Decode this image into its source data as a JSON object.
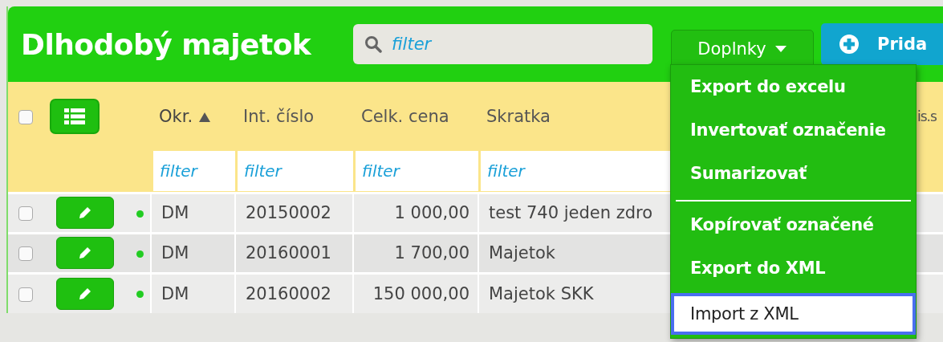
{
  "title": "Dlhodobý majetok",
  "search": {
    "placeholder": "filter"
  },
  "tools_button": {
    "label": "Doplnky",
    "expanded": true
  },
  "add_button": {
    "label": "Prida"
  },
  "header": {
    "select_all_checked": false
  },
  "columns": [
    {
      "label": "Okr.",
      "sorted": true,
      "filter_placeholder": "filter"
    },
    {
      "label": "Int. číslo",
      "sorted": false,
      "filter_placeholder": "filter"
    },
    {
      "label": "Celk. cena",
      "sorted": false,
      "filter_placeholder": "filter"
    },
    {
      "label": "Skratka",
      "sorted": false,
      "filter_placeholder": "filter"
    },
    {
      "label": "is.s",
      "sorted": false
    }
  ],
  "rows": [
    {
      "checked": false,
      "color": "#22cc22",
      "okr": "DM",
      "int_cislo": "20150002",
      "celk_cena": "1 000,00",
      "skratka": "test 740 jeden zdro"
    },
    {
      "checked": false,
      "color": "#22cc22",
      "okr": "DM",
      "int_cislo": "20160001",
      "celk_cena": "1 700,00",
      "skratka": "Majetok"
    },
    {
      "checked": false,
      "color": "#22cc22",
      "okr": "DM",
      "int_cislo": "20160002",
      "celk_cena": "150 000,00",
      "skratka": "Majetok SKK"
    }
  ],
  "menu": [
    {
      "kind": "item",
      "label": "Export do excelu",
      "highlighted": false
    },
    {
      "kind": "item",
      "label": "Invertovať označenie",
      "highlighted": false
    },
    {
      "kind": "item",
      "label": "Sumarizovať",
      "highlighted": false
    },
    {
      "kind": "divider"
    },
    {
      "kind": "item",
      "label": "Kopírovať označené",
      "highlighted": false
    },
    {
      "kind": "item",
      "label": "Export do XML",
      "highlighted": false
    },
    {
      "kind": "item",
      "label": "Import z XML",
      "highlighted": true
    }
  ]
}
